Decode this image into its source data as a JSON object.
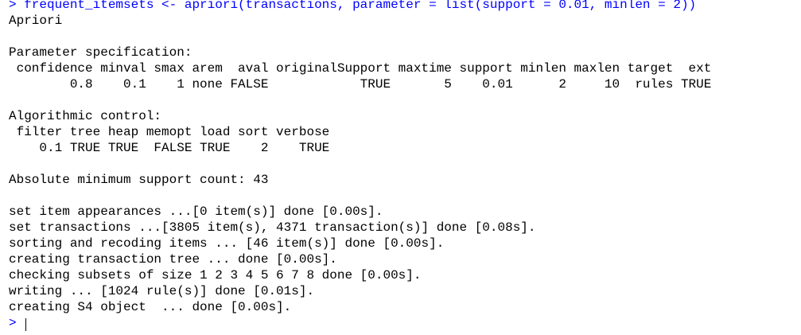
{
  "console": {
    "command_line": "> frequent_itemsets <- apriori(transactions, parameter = list(support = 0.01, minlen = 2))",
    "output": [
      "Apriori",
      "",
      "Parameter specification:",
      " confidence minval smax arem  aval originalSupport maxtime support minlen maxlen target  ext",
      "        0.8    0.1    1 none FALSE            TRUE       5    0.01      2     10  rules TRUE",
      "",
      "Algorithmic control:",
      " filter tree heap memopt load sort verbose",
      "    0.1 TRUE TRUE  FALSE TRUE    2    TRUE",
      "",
      "Absolute minimum support count: 43",
      "",
      "set item appearances ...[0 item(s)] done [0.00s].",
      "set transactions ...[3805 item(s), 4371 transaction(s)] done [0.08s].",
      "sorting and recoding items ... [46 item(s)] done [0.00s].",
      "creating transaction tree ... done [0.00s].",
      "checking subsets of size 1 2 3 4 5 6 7 8 done [0.00s].",
      "writing ... [1024 rule(s)] done [0.01s].",
      "creating S4 object  ... done [0.00s]."
    ],
    "prompt": "> ",
    "colors": {
      "command": "#0000ff",
      "output": "#000000",
      "background": "#ffffff"
    }
  }
}
